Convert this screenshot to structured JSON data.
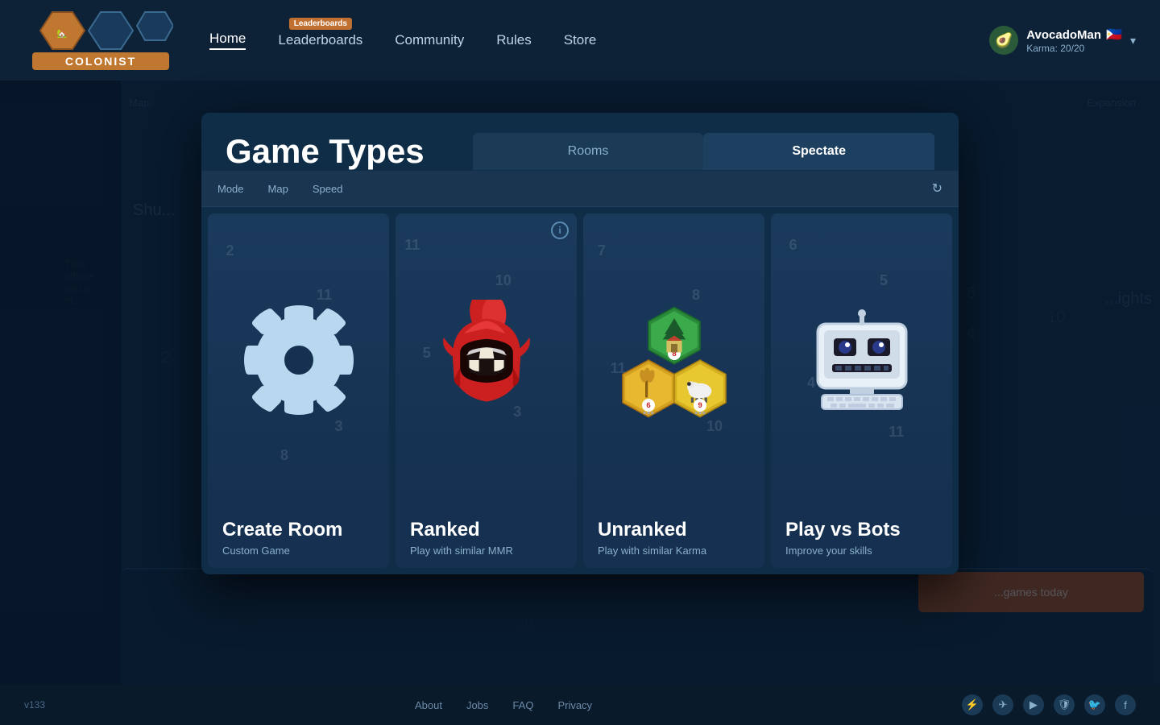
{
  "nav": {
    "logo_text": "COLONIST",
    "links": [
      {
        "label": "Home",
        "active": true,
        "beta": false
      },
      {
        "label": "Leaderboards",
        "active": false,
        "beta": true
      },
      {
        "label": "Community",
        "active": false,
        "beta": false
      },
      {
        "label": "Rules",
        "active": false,
        "beta": false
      },
      {
        "label": "Store",
        "active": false,
        "beta": false
      }
    ],
    "user": {
      "name": "AvocadoMan",
      "karma_label": "Karma: 20/20",
      "flag": "🇵🇭",
      "avatar_emoji": "🥑"
    }
  },
  "modal": {
    "title": "Game Types",
    "tabs": [
      {
        "label": "Rooms",
        "active": false
      },
      {
        "label": "Spectate",
        "active": true
      }
    ],
    "filters": {
      "mode_label": "Mode",
      "map_label": "Map",
      "speed_label": "Speed"
    },
    "cards": [
      {
        "id": "create-room",
        "title": "Create Room",
        "subtitle": "Custom Game",
        "icon_type": "gear"
      },
      {
        "id": "ranked",
        "title": "Ranked",
        "subtitle": "Play with similar MMR",
        "icon_type": "helmet",
        "has_info": true
      },
      {
        "id": "unranked",
        "title": "Unranked",
        "subtitle": "Play with similar Karma",
        "icon_type": "hexes"
      },
      {
        "id": "play-vs-bots",
        "title": "Play vs Bots",
        "subtitle": "Improve your skills",
        "icon_type": "bot"
      }
    ]
  },
  "footer": {
    "version": "v133",
    "links": [
      "About",
      "Jobs",
      "FAQ",
      "Privacy"
    ],
    "social_icons": [
      "discord",
      "telegram",
      "youtube",
      "shield",
      "twitter",
      "facebook"
    ]
  }
}
